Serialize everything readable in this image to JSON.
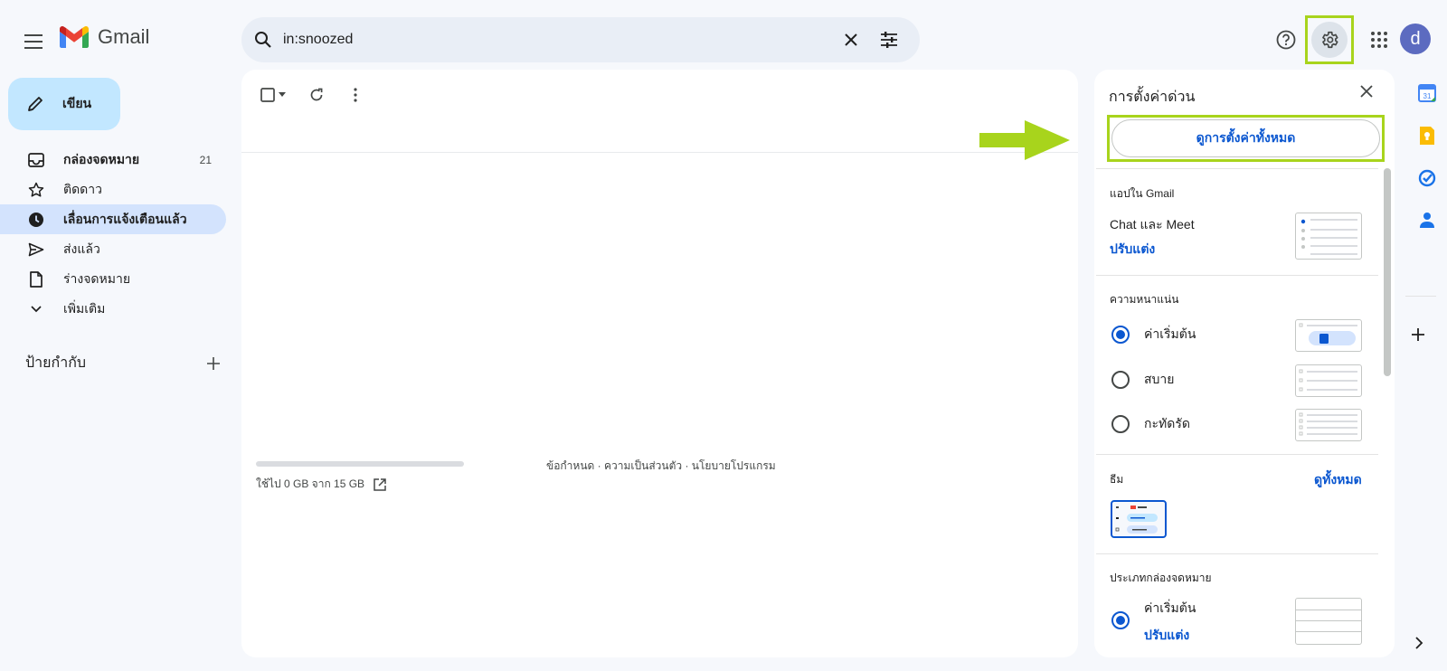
{
  "header": {
    "app_name": "Gmail",
    "search_query": "in:snoozed"
  },
  "avatar_letter": "d",
  "compose_label": "เขียน",
  "nav": {
    "items": [
      {
        "label": "กล่องจดหมาย",
        "count": "21"
      },
      {
        "label": "ติดดาว"
      },
      {
        "label": "เลื่อนการแจ้งเตือนแล้ว"
      },
      {
        "label": "ส่งแล้ว"
      },
      {
        "label": "ร่างจดหมาย"
      },
      {
        "label": "เพิ่มเติม"
      }
    ],
    "labels_title": "ป้ายกำกับ"
  },
  "main": {
    "storage_text": "ใช้ไป 0 GB จาก 15 GB",
    "storage_used_fraction": 0,
    "footer_links": "ข้อกำหนด · ความเป็นส่วนตัว · นโยบายโปรแกรม"
  },
  "quick_settings": {
    "title": "การตั้งค่าด่วน",
    "see_all": "ดูการตั้งค่าทั้งหมด",
    "apps_section": "แอปใน Gmail",
    "chat_meet": "Chat และ Meet",
    "customize": "ปรับแต่ง",
    "density_section": "ความหนาแน่น",
    "density_options": [
      {
        "label": "ค่าเริ่มต้น",
        "selected": true
      },
      {
        "label": "สบาย",
        "selected": false
      },
      {
        "label": "กะทัดรัด",
        "selected": false
      }
    ],
    "theme_section": "ธีม",
    "theme_view_all": "ดูทั้งหมด",
    "inbox_type_section": "ประเภทกล่องจดหมาย",
    "inbox_default": "ค่าเริ่มต้น",
    "inbox_customize": "ปรับแต่ง"
  },
  "colors": {
    "highlight": "#a8d41c",
    "accent": "#0b57d0",
    "active_nav": "#d3e3fd",
    "compose": "#c2e7ff"
  }
}
